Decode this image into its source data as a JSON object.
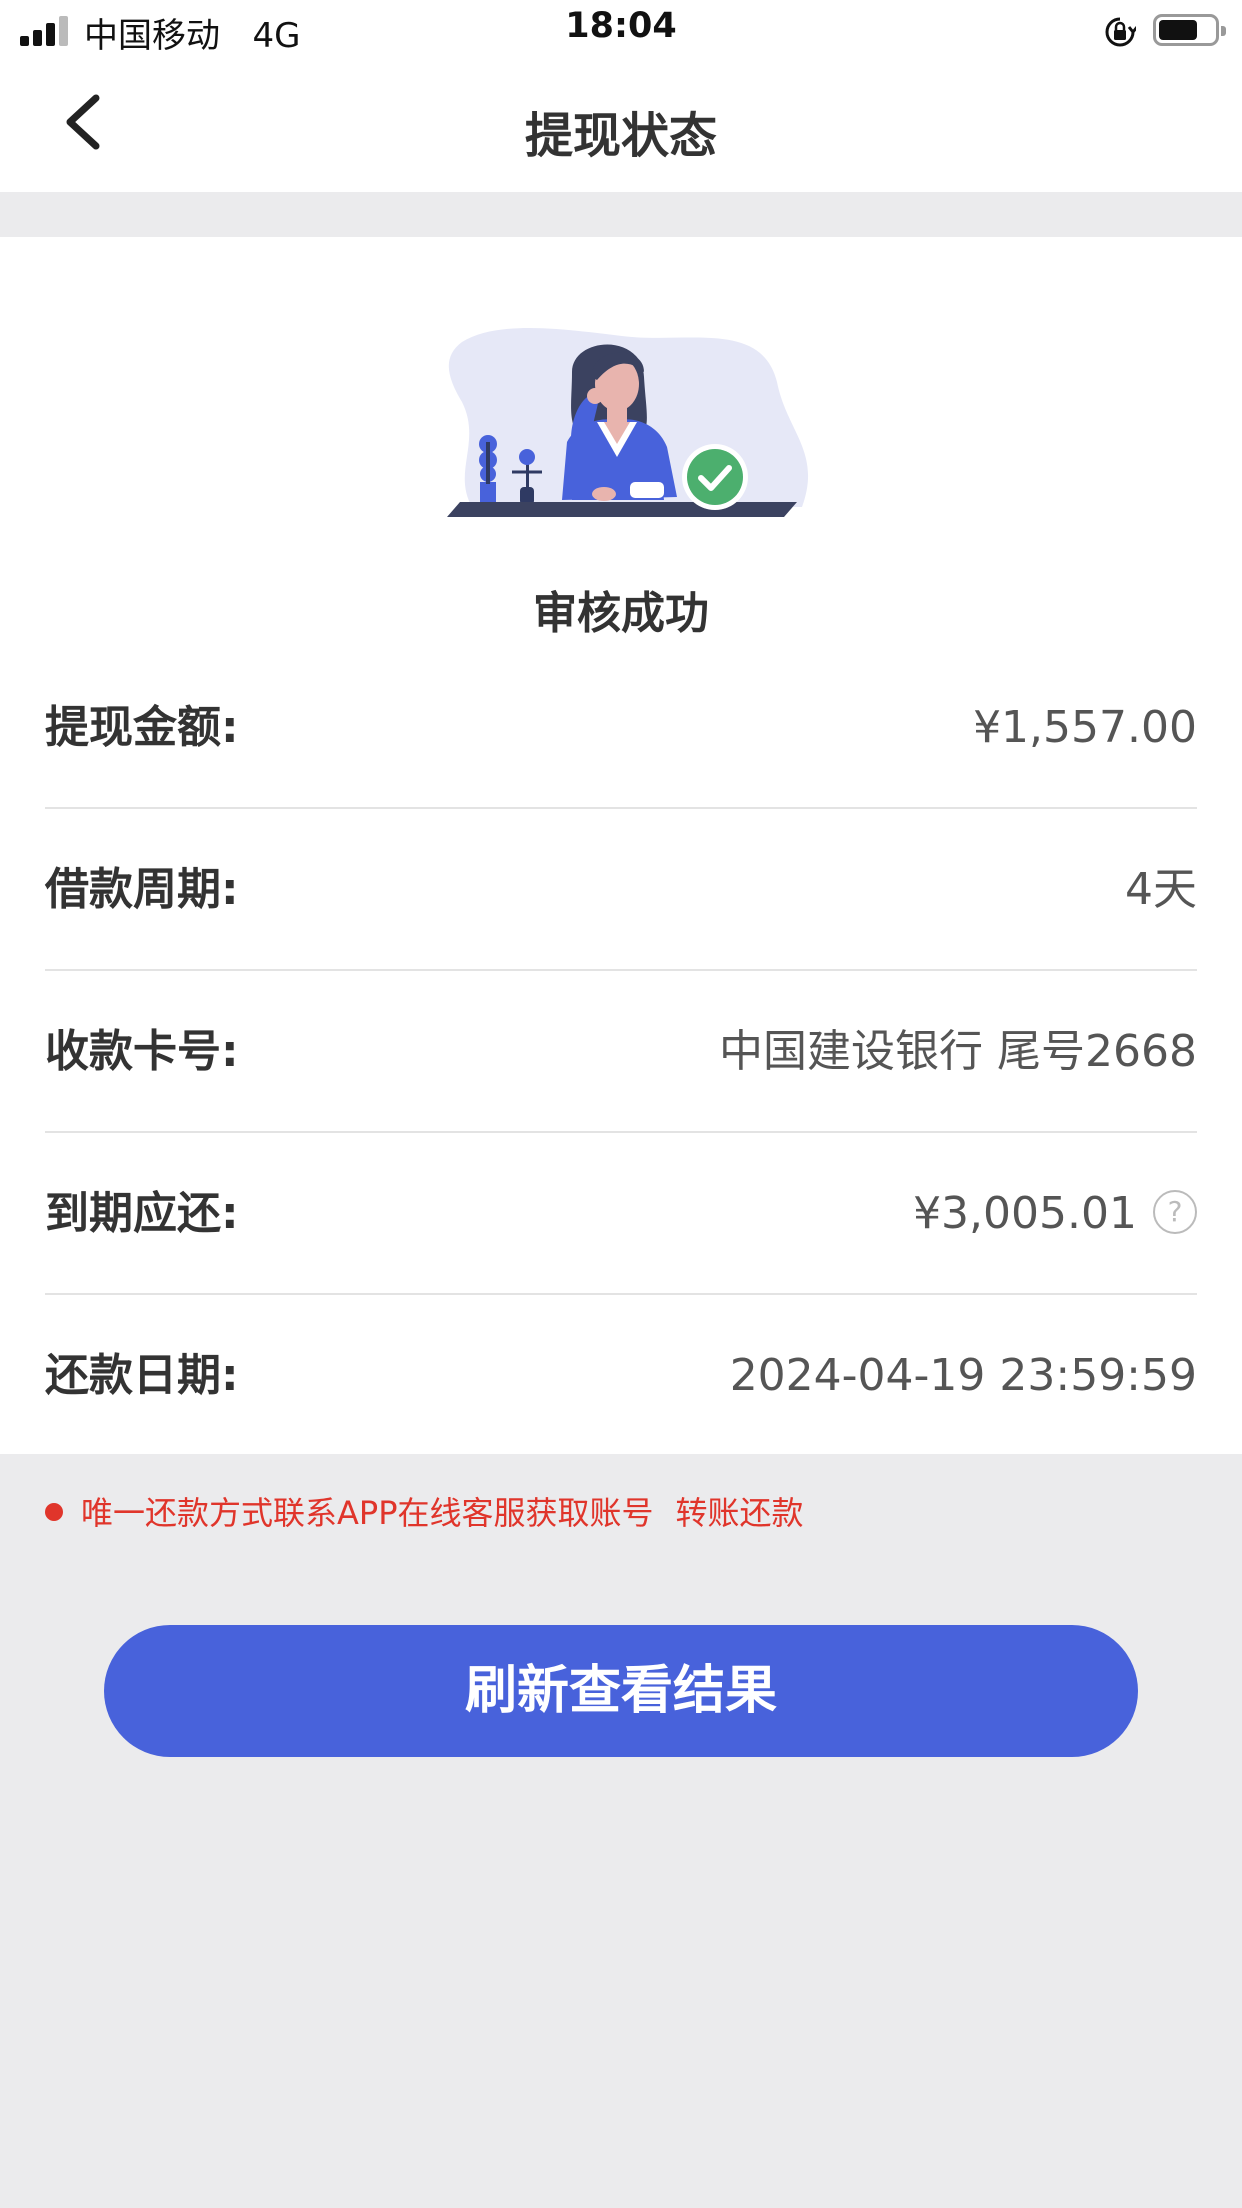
{
  "status_bar": {
    "carrier": "中国移动",
    "network": "4G",
    "time": "18:04"
  },
  "nav": {
    "title": "提现状态",
    "back_icon": "chevron-left-icon"
  },
  "result": {
    "illustration": "woman-at-desk-with-check-illustration",
    "status_text": "审核成功"
  },
  "details": [
    {
      "label": "提现金额:",
      "value": "¥1,557.00"
    },
    {
      "label": "借款周期:",
      "value": "4天"
    },
    {
      "label": "收款卡号:",
      "value": "中国建设银行 尾号2668"
    },
    {
      "label": "到期应还:",
      "value": "¥3,005.01",
      "help_icon": "question-circle-icon",
      "help_glyph": "?"
    },
    {
      "label": "还款日期:",
      "value": "2024-04-19 23:59:59"
    }
  ],
  "notice": {
    "text": "唯一还款方式联系APP在线客服获取账号",
    "action": "转账还款"
  },
  "button": {
    "label": "刷新查看结果"
  },
  "colors": {
    "primary": "#4862db",
    "alert": "#e0352b",
    "success": "#4caf6e",
    "background": "#ebebed"
  }
}
